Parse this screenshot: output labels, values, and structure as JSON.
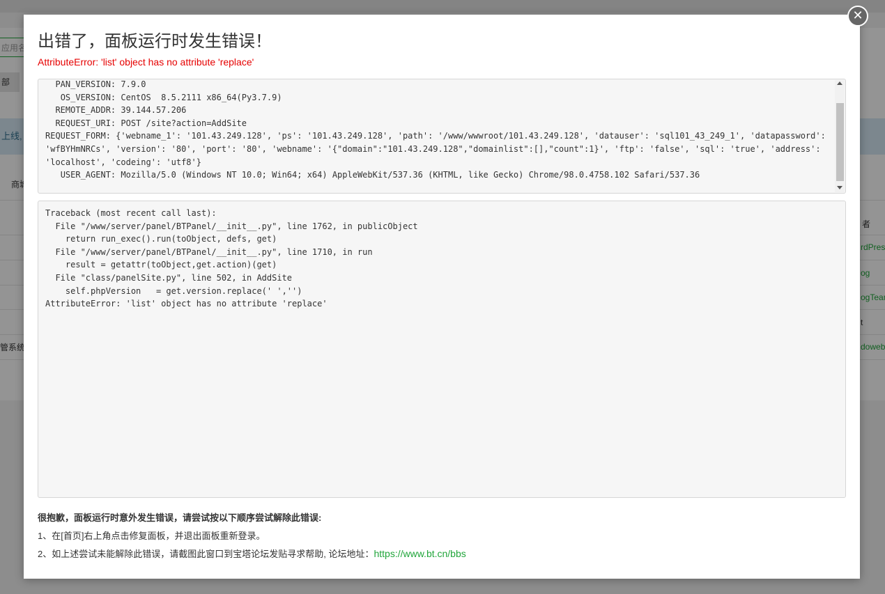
{
  "background": {
    "search_placeholder": "应用名",
    "filter_button": "部",
    "notice": "上线,",
    "category": "商城",
    "column_header": "者",
    "row_label": "管系统",
    "row_links": [
      "rdPress",
      "og",
      "ogTeam",
      "t",
      "doweb"
    ]
  },
  "modal": {
    "title": "出错了，面板运行时发生错误！",
    "error_message": "AttributeError: 'list' object has no attribute 'replace'",
    "info_lines": [
      "  PAN_VERSION: 7.9.0",
      "   OS_VERSION: CentOS  8.5.2111 x86_64(Py3.7.9)",
      "  REMOTE_ADDR: 39.144.57.206",
      "  REQUEST_URI: POST /site?action=AddSite",
      "REQUEST_FORM: {'webname_1': '101.43.249.128', 'ps': '101.43.249.128', 'path': '/www/wwwroot/101.43.249.128', 'datauser': 'sql101_43_249_1', 'datapassword': 'wfBYHmNRCs', 'version': '80', 'port': '80', 'webname': '{\"domain\":\"101.43.249.128\",\"domainlist\":[],\"count\":1}', 'ftp': 'false', 'sql': 'true', 'address': 'localhost', 'codeing': 'utf8'}",
      "   USER_AGENT: Mozilla/5.0 (Windows NT 10.0; Win64; x64) AppleWebKit/537.36 (KHTML, like Gecko) Chrome/98.0.4758.102 Safari/537.36"
    ],
    "traceback": [
      "Traceback (most recent call last):",
      "  File \"/www/server/panel/BTPanel/__init__.py\", line 1762, in publicObject",
      "    return run_exec().run(toObject, defs, get)",
      "  File \"/www/server/panel/BTPanel/__init__.py\", line 1710, in run",
      "    result = getattr(toObject,get.action)(get)",
      "  File \"class/panelSite.py\", line 502, in AddSite",
      "    self.phpVersion   = get.version.replace(' ','')",
      "AttributeError: 'list' object has no attribute 'replace'"
    ],
    "help": {
      "title": "很抱歉，面板运行时意外发生错误，请尝试按以下顺序尝试解除此错误:",
      "step1": "1、在[首页]右上角点击修复面板，并退出面板重新登录。",
      "step2_prefix": "2、如上述尝试未能解除此错误，请截图此窗口到宝塔论坛发贴寻求帮助, 论坛地址：",
      "forum_url": "https://www.bt.cn/bbs"
    },
    "close_symbol": "✕"
  },
  "colors": {
    "accent": "#20a53a",
    "error": "#e60000"
  }
}
